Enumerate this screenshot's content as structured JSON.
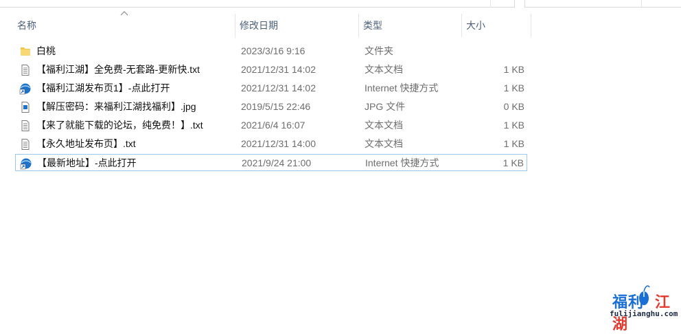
{
  "columns": {
    "name": "名称",
    "date": "修改日期",
    "type": "类型",
    "size": "大小"
  },
  "files": [
    {
      "icon": "folder-icon",
      "name": "白桃",
      "date": "2023/3/16 9:16",
      "type": "文件夹",
      "size": ""
    },
    {
      "icon": "text-file-icon",
      "name": "【福利江湖】全免费-无套路-更新快.txt",
      "date": "2021/12/31 14:02",
      "type": "文本文档",
      "size": "1 KB"
    },
    {
      "icon": "internet-shortcut-icon",
      "name": "【福利江湖发布页1】-点此打开",
      "date": "2021/12/31 14:02",
      "type": "Internet 快捷方式",
      "size": "1 KB"
    },
    {
      "icon": "jpg-file-icon",
      "name": "【解压密码：来福利江湖找福利】.jpg",
      "date": "2019/5/15 22:46",
      "type": "JPG 文件",
      "size": "0 KB"
    },
    {
      "icon": "text-file-icon",
      "name": "【来了就能下载的论坛，纯免费！】.txt",
      "date": "2021/6/4 16:07",
      "type": "文本文档",
      "size": "1 KB"
    },
    {
      "icon": "text-file-icon",
      "name": "【永久地址发布页】.txt",
      "date": "2021/12/31 14:00",
      "type": "文本文档",
      "size": "1 KB"
    },
    {
      "icon": "internet-shortcut-icon",
      "name": "【最新地址】-点此打开",
      "date": "2021/9/24 21:00",
      "type": "Internet 快捷方式",
      "size": "1 KB"
    }
  ],
  "watermark": {
    "title": "福利江湖",
    "url": "fulijianghu.com"
  },
  "colors": {
    "header_text": "#4c607a",
    "selection_border": "#99c9ef",
    "folder": "#f2c84b",
    "shortcut_blue": "#1e73c8",
    "watermark_blue": "#1a6fd6",
    "watermark_red": "#e23b2f"
  }
}
